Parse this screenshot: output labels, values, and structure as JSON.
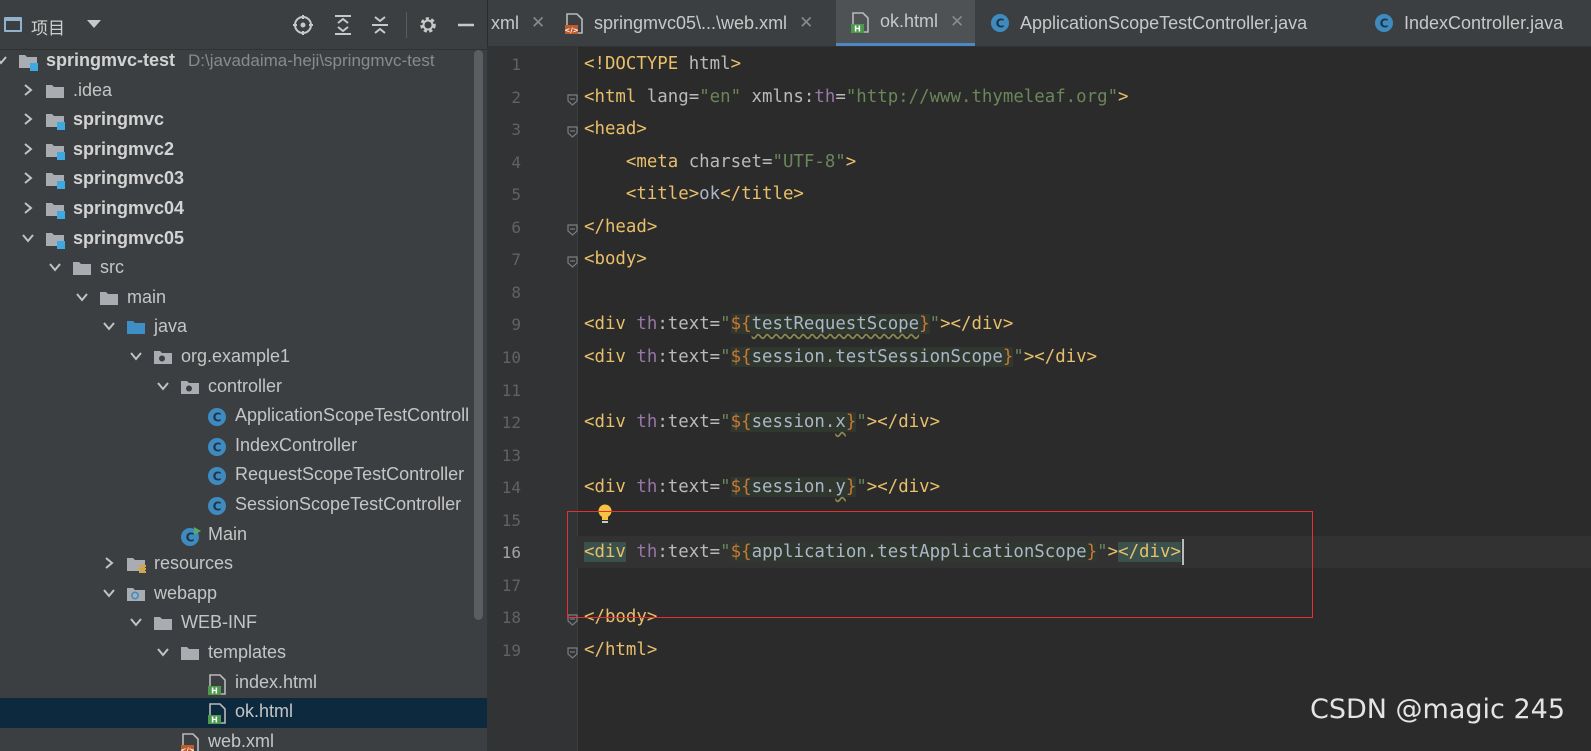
{
  "project_panel": {
    "title": "项目",
    "tree": [
      {
        "label": "springmvc-test",
        "path": "D:\\javadaima-heji\\springmvc-test",
        "icon": "module-folder-icon",
        "arrow": "down",
        "bold": true,
        "name": "tree-item-springmvc-test"
      },
      {
        "label": ".idea",
        "icon": "folder-icon",
        "arrow": "right",
        "name": "tree-item-idea"
      },
      {
        "label": "springmvc",
        "icon": "module-folder-icon",
        "arrow": "right",
        "bold": true,
        "name": "tree-item-springmvc"
      },
      {
        "label": "springmvc2",
        "icon": "module-folder-icon",
        "arrow": "right",
        "bold": true,
        "name": "tree-item-springmvc2"
      },
      {
        "label": "springmvc03",
        "icon": "module-folder-icon",
        "arrow": "right",
        "bold": true,
        "name": "tree-item-springmvc03"
      },
      {
        "label": "springmvc04",
        "icon": "module-folder-icon",
        "arrow": "right",
        "bold": true,
        "name": "tree-item-springmvc04"
      },
      {
        "label": "springmvc05",
        "icon": "module-folder-icon",
        "arrow": "down",
        "bold": true,
        "name": "tree-item-springmvc05"
      },
      {
        "label": "src",
        "icon": "folder-icon",
        "arrow": "down",
        "name": "tree-item-src"
      },
      {
        "label": "main",
        "icon": "folder-icon",
        "arrow": "down",
        "name": "tree-item-main"
      },
      {
        "label": "java",
        "icon": "source-folder-icon",
        "arrow": "down",
        "name": "tree-item-java"
      },
      {
        "label": "org.example1",
        "icon": "package-icon",
        "arrow": "down",
        "name": "tree-item-org-example1"
      },
      {
        "label": "controller",
        "icon": "package-icon",
        "arrow": "down",
        "name": "tree-item-controller"
      },
      {
        "label": "ApplicationScopeTestControll",
        "icon": "class-icon",
        "arrow": "",
        "name": "tree-item-applicationscopetestcontroller"
      },
      {
        "label": "IndexController",
        "icon": "class-icon",
        "arrow": "",
        "name": "tree-item-indexcontroller"
      },
      {
        "label": "RequestScopeTestController",
        "icon": "class-icon",
        "arrow": "",
        "name": "tree-item-requestscopetestcontroller"
      },
      {
        "label": "SessionScopeTestController",
        "icon": "class-icon",
        "arrow": "",
        "name": "tree-item-sessionscopetestcontroller"
      },
      {
        "label": "Main",
        "icon": "main-class-icon",
        "arrow": "",
        "name": "tree-item-main-class"
      },
      {
        "label": "resources",
        "icon": "resources-folder-icon",
        "arrow": "right",
        "name": "tree-item-resources"
      },
      {
        "label": "webapp",
        "icon": "web-folder-icon",
        "arrow": "down",
        "name": "tree-item-webapp"
      },
      {
        "label": "WEB-INF",
        "icon": "folder-icon",
        "arrow": "down",
        "name": "tree-item-web-inf"
      },
      {
        "label": "templates",
        "icon": "folder-icon",
        "arrow": "down",
        "name": "tree-item-templates"
      },
      {
        "label": "index.html",
        "icon": "html-file-icon",
        "arrow": "",
        "name": "tree-item-index-html"
      },
      {
        "label": "ok.html",
        "icon": "html-file-icon",
        "arrow": "",
        "selected": true,
        "name": "tree-item-ok-html"
      },
      {
        "label": "web.xml",
        "icon": "xml-file-icon",
        "arrow": "",
        "name": "tree-item-web-xml"
      }
    ]
  },
  "tabs": [
    {
      "label": "xml",
      "icon": "",
      "name": "tab-xml"
    },
    {
      "label": "springmvc05\\...\\web.xml",
      "icon": "xml-file-icon",
      "name": "tab-web-xml"
    },
    {
      "label": "ok.html",
      "icon": "html-file-icon",
      "active": true,
      "name": "tab-ok-html"
    },
    {
      "label": "ApplicationScopeTestController.java",
      "icon": "class-icon",
      "name": "tab-applicationscopetestcontroller"
    },
    {
      "label": "IndexController.java",
      "icon": "class-icon",
      "name": "tab-indexcontroller"
    }
  ],
  "editor": {
    "current_line": 16,
    "line_numbers": [
      "1",
      "2",
      "3",
      "4",
      "5",
      "6",
      "7",
      "8",
      "9",
      "10",
      "11",
      "12",
      "13",
      "14",
      "15",
      "16",
      "17",
      "18",
      "19"
    ],
    "lines": [
      [
        {
          "t": "<!DOCTYPE ",
          "c": "tag"
        },
        {
          "t": "html",
          "c": "attr"
        },
        {
          "t": ">",
          "c": "tag"
        }
      ],
      [
        {
          "t": "<html ",
          "c": "tag"
        },
        {
          "t": "lang=",
          "c": "attr"
        },
        {
          "t": "\"en\"",
          "c": "str"
        },
        {
          "t": " xmlns:",
          "c": "attr"
        },
        {
          "t": "th",
          "c": "ns"
        },
        {
          "t": "=",
          "c": "attr"
        },
        {
          "t": "\"http://www.thymeleaf.org\"",
          "c": "str"
        },
        {
          "t": ">",
          "c": "tag"
        }
      ],
      [
        {
          "t": "<head>",
          "c": "tag"
        }
      ],
      [
        {
          "t": "    <meta ",
          "c": "tag"
        },
        {
          "t": "charset=",
          "c": "attr"
        },
        {
          "t": "\"UTF-8\"",
          "c": "str"
        },
        {
          "t": ">",
          "c": "tag"
        }
      ],
      [
        {
          "t": "    <title>",
          "c": "tag"
        },
        {
          "t": "ok",
          "c": "txt"
        },
        {
          "t": "</title>",
          "c": "tag"
        }
      ],
      [
        {
          "t": "</head>",
          "c": "tag"
        }
      ],
      [
        {
          "t": "<body>",
          "c": "tag"
        }
      ],
      [],
      [
        {
          "t": "<div ",
          "c": "tag"
        },
        {
          "t": "th",
          "c": "ns"
        },
        {
          "t": ":text=",
          "c": "attr"
        },
        {
          "t": "\"",
          "c": "str"
        },
        {
          "t": "${",
          "c": "brace tpl"
        },
        {
          "t": "testRequestScope",
          "c": "tpl uline"
        },
        {
          "t": "}",
          "c": "brace tpl"
        },
        {
          "t": "\"",
          "c": "str"
        },
        {
          "t": "></div>",
          "c": "tag"
        }
      ],
      [
        {
          "t": "<div ",
          "c": "tag"
        },
        {
          "t": "th",
          "c": "ns"
        },
        {
          "t": ":text=",
          "c": "attr"
        },
        {
          "t": "\"",
          "c": "str"
        },
        {
          "t": "${",
          "c": "brace tpl"
        },
        {
          "t": "session.testSessionScope",
          "c": "tpl"
        },
        {
          "t": "}",
          "c": "brace tpl"
        },
        {
          "t": "\"",
          "c": "str"
        },
        {
          "t": "></div>",
          "c": "tag"
        }
      ],
      [],
      [
        {
          "t": "<div ",
          "c": "tag"
        },
        {
          "t": "th",
          "c": "ns"
        },
        {
          "t": ":text=",
          "c": "attr"
        },
        {
          "t": "\"",
          "c": "str"
        },
        {
          "t": "${",
          "c": "brace tpl"
        },
        {
          "t": "session.",
          "c": "tpl"
        },
        {
          "t": "x",
          "c": "tpl uline"
        },
        {
          "t": "}",
          "c": "brace tpl"
        },
        {
          "t": "\"",
          "c": "str"
        },
        {
          "t": "></div>",
          "c": "tag"
        }
      ],
      [],
      [
        {
          "t": "<div ",
          "c": "tag"
        },
        {
          "t": "th",
          "c": "ns"
        },
        {
          "t": ":text=",
          "c": "attr"
        },
        {
          "t": "\"",
          "c": "str"
        },
        {
          "t": "${",
          "c": "brace tpl"
        },
        {
          "t": "session.",
          "c": "tpl"
        },
        {
          "t": "y",
          "c": "tpl uline"
        },
        {
          "t": "}",
          "c": "brace tpl"
        },
        {
          "t": "\"",
          "c": "str"
        },
        {
          "t": "></div>",
          "c": "tag"
        }
      ],
      [],
      [
        {
          "t": "<div",
          "c": "tag hlt"
        },
        {
          "t": " ",
          "c": "attr"
        },
        {
          "t": "th",
          "c": "ns"
        },
        {
          "t": ":text=",
          "c": "attr"
        },
        {
          "t": "\"",
          "c": "str"
        },
        {
          "t": "${",
          "c": "brace tpl"
        },
        {
          "t": "application.testApplicationScope",
          "c": "tpl"
        },
        {
          "t": "}",
          "c": "brace tpl"
        },
        {
          "t": "\"",
          "c": "str"
        },
        {
          "t": ">",
          "c": "tag"
        },
        {
          "t": "</div>",
          "c": "tag hlt"
        }
      ],
      [],
      [
        {
          "t": "</body>",
          "c": "tag"
        }
      ],
      [
        {
          "t": "</html>",
          "c": "tag"
        }
      ]
    ],
    "fold_lines": [
      2,
      3,
      6,
      7,
      18,
      19
    ]
  },
  "colors": {
    "highlight_box": "#e53030",
    "active_tab_underline": "#4a88c7",
    "selected_row": "#0d293e"
  },
  "watermark": "CSDN @magic 245"
}
